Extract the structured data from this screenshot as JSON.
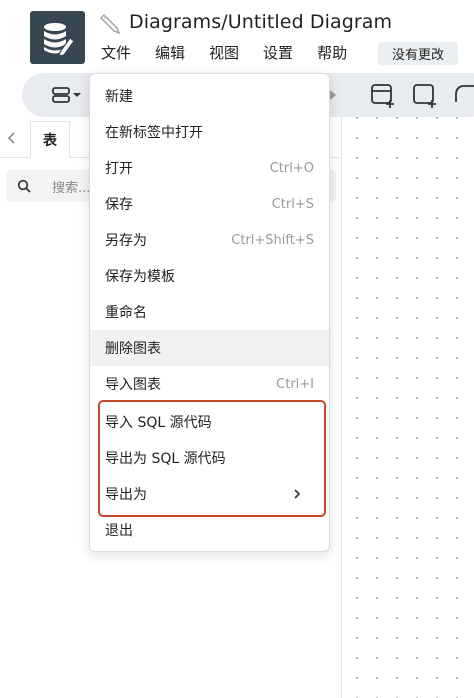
{
  "header": {
    "title": "Diagrams/Untitled Diagram",
    "menus": [
      "文件",
      "编辑",
      "视图",
      "设置",
      "帮助"
    ],
    "status_badge": "没有更改"
  },
  "sidebar": {
    "tab_label": "表",
    "search_placeholder": "搜索..."
  },
  "file_menu": {
    "items": [
      {
        "label": "新建",
        "shortcut": ""
      },
      {
        "label": "在新标签中打开",
        "shortcut": ""
      },
      {
        "label": "打开",
        "shortcut": "Ctrl+O"
      },
      {
        "label": "保存",
        "shortcut": "Ctrl+S"
      },
      {
        "label": "另存为",
        "shortcut": "Ctrl+Shift+S"
      },
      {
        "label": "保存为模板",
        "shortcut": ""
      },
      {
        "label": "重命名",
        "shortcut": ""
      },
      {
        "label": "删除图表",
        "shortcut": ""
      },
      {
        "label": "导入图表",
        "shortcut": "Ctrl+I"
      },
      {
        "label": "导入 SQL 源代码",
        "shortcut": ""
      },
      {
        "label": "导出为 SQL 源代码",
        "shortcut": ""
      },
      {
        "label": "导出为",
        "shortcut": "",
        "submenu": true
      },
      {
        "label": "退出",
        "shortcut": ""
      }
    ],
    "hovered_index": 7,
    "highlighted_items": [
      9,
      10,
      11
    ]
  },
  "colors": {
    "logo_bg": "#37474f",
    "highlight_border": "#c9492a",
    "toolbar_bg": "#e8ebef"
  }
}
